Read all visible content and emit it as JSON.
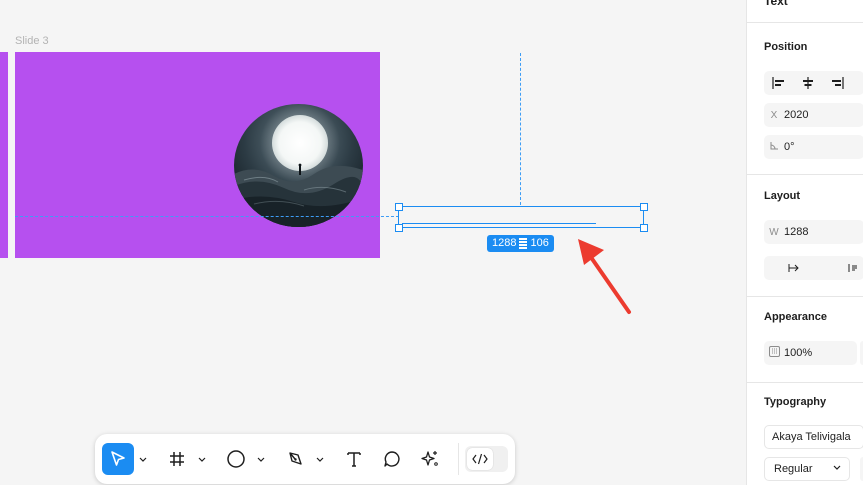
{
  "canvas": {
    "slide_label": "Slide 3",
    "slide_color": "#b650ef",
    "dimension_badge": {
      "width": "1288",
      "height": "106"
    },
    "accent": "#1b8cf2",
    "arrow_color": "#ec3b2f"
  },
  "toolbar": {
    "tools": [
      {
        "name": "move-tool",
        "icon": "cursor-arrow-icon",
        "active": true
      },
      {
        "name": "frame-tool",
        "icon": "hash-icon"
      },
      {
        "name": "shape-tool",
        "icon": "circle-icon"
      },
      {
        "name": "pen-tool",
        "icon": "pen-nib-icon"
      },
      {
        "name": "text-tool",
        "icon": "text-t-icon"
      },
      {
        "name": "comment-tool",
        "icon": "speech-bubble-icon"
      },
      {
        "name": "actions-tool",
        "icon": "sparkle-icon"
      }
    ],
    "dev_mode_icon": "code-brackets-icon"
  },
  "panel": {
    "top_label": "Text",
    "position": {
      "title": "Position",
      "x_label": "X",
      "x_value": "2020",
      "rotation_value": "0°"
    },
    "layout": {
      "title": "Layout",
      "w_label": "W",
      "w_value": "1288"
    },
    "appearance": {
      "title": "Appearance",
      "opacity_value": "100%"
    },
    "typography": {
      "title": "Typography",
      "font_family": "Akaya Telivigala",
      "font_weight": "Regular"
    }
  }
}
